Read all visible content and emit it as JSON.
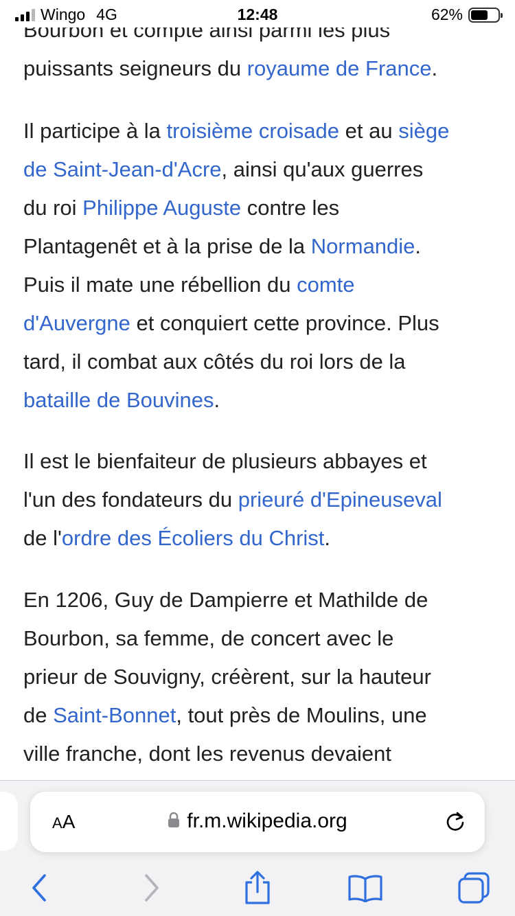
{
  "status_bar": {
    "carrier": "Wingo",
    "network": "4G",
    "time": "12:48",
    "battery": "62%",
    "battery_level": 0.62
  },
  "article": {
    "p1": {
      "line1": "Bourbon et compte ainsi parmi les plus",
      "line2_a": "puissants seigneurs du ",
      "line2_link": "royaume de France",
      "line2_b": "."
    },
    "p2": {
      "l1_a": "Il participe à la ",
      "l1_link1": "troisième croisade",
      "l1_b": " et au ",
      "l1_link2": "siège",
      "l2_link": "de Saint-Jean-d'Acre",
      "l2_b": ", ainsi qu'aux guerres",
      "l3_a": "du roi ",
      "l3_link": "Philippe Auguste",
      "l3_b": " contre les",
      "l4_a": "Plantagenêt et à la prise de la ",
      "l4_link": "Normandie",
      "l4_b": ".",
      "l5_a": "Puis il mate une rébellion du ",
      "l5_link": "comte",
      "l6_link": "d'Auvergne",
      "l6_b": " et conquiert cette province. Plus",
      "l7": "tard, il combat aux côtés du roi lors de la",
      "l8_link": "bataille de Bouvines",
      "l8_b": "."
    },
    "p3": {
      "l1": "Il est le bienfaiteur de plusieurs abbayes et",
      "l2_a": "l'un des fondateurs du ",
      "l2_link": "prieuré d'Epineuseval",
      "l3_a": "de l'",
      "l3_link": "ordre des Écoliers du Christ",
      "l3_b": "."
    },
    "p4": {
      "l1": "En 1206, Guy de Dampierre et Mathilde de",
      "l2": "Bourbon, sa femme, de concert avec le",
      "l3": "prieur de Souvigny, créèrent, sur la hauteur",
      "l4_a": "de ",
      "l4_link": "Saint-Bonnet",
      "l4_b": ", tout près de Moulins, une",
      "l5": "ville franche, dont les revenus devaient"
    }
  },
  "toolbar": {
    "aa_small": "A",
    "aa_large": "A",
    "url": "fr.m.wikipedia.org",
    "icons": [
      "lock-icon",
      "reload-icon",
      "back-icon",
      "forward-icon",
      "share-icon",
      "bookmarks-icon",
      "tabs-icon"
    ]
  },
  "colors": {
    "link": "#3366cc",
    "text": "#202122",
    "toolbar_bg": "#f2f2f4",
    "accent": "#2f6fe0",
    "disabled": "#b4b4b8"
  }
}
